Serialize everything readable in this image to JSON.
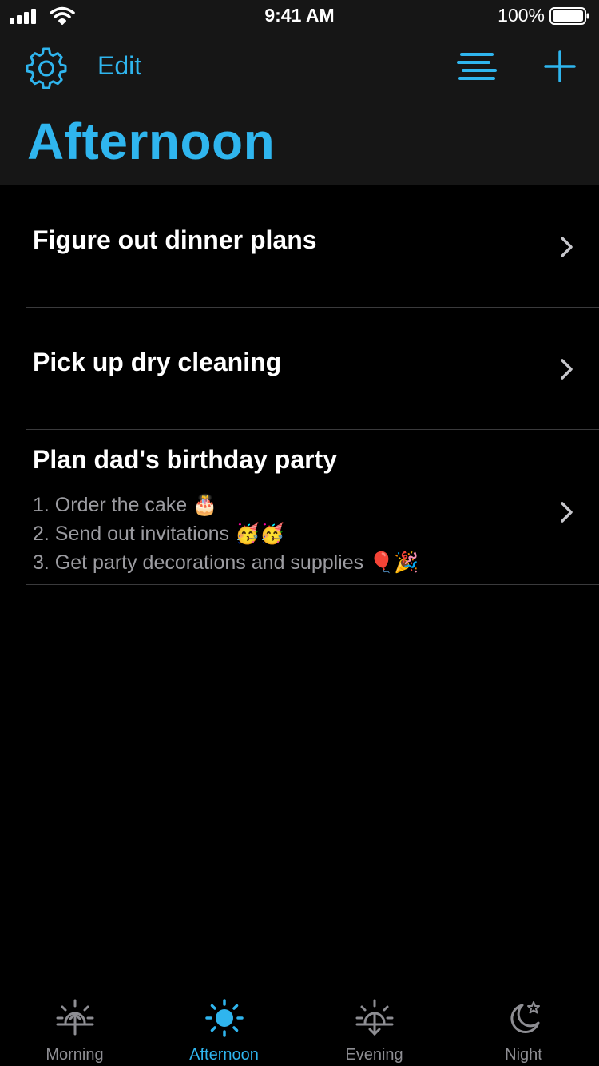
{
  "status_bar": {
    "time": "9:41 AM",
    "battery_percent": "100%",
    "battery_level": 1.0,
    "signal_bars": 4
  },
  "toolbar": {
    "settings_icon": "gear-icon",
    "edit_label": "Edit",
    "list_icon": "list-icon",
    "add_icon": "plus-icon"
  },
  "page_title": "Afternoon",
  "tasks": [
    {
      "title": "Figure out dinner plans",
      "notes": []
    },
    {
      "title": "Pick up dry cleaning",
      "notes": []
    },
    {
      "title": "Plan dad's birthday party",
      "notes": [
        "1. Order the cake 🎂",
        "2. Send out invitations 🥳🥳",
        "3. Get party decorations and supplies 🎈🎉"
      ]
    }
  ],
  "tabs": [
    {
      "label": "Morning",
      "icon": "sunrise-icon",
      "active": false
    },
    {
      "label": "Afternoon",
      "icon": "sun-icon",
      "active": true
    },
    {
      "label": "Evening",
      "icon": "sunset-icon",
      "active": false
    },
    {
      "label": "Night",
      "icon": "moon-star-icon",
      "active": false
    }
  ],
  "colors": {
    "accent": "#2fb5ee",
    "header_bg": "#161616",
    "background": "#000000",
    "divider": "#3a3a3c",
    "inactive_tab": "#8e8e93",
    "notes_text": "#9c9ca1"
  }
}
